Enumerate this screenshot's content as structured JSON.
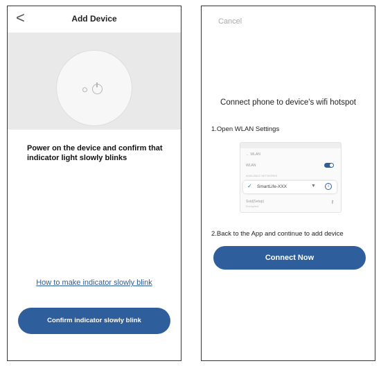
{
  "left_screen": {
    "back_glyph": "<",
    "title": "Add Device",
    "instruction": "Power on the device and confirm that indicator light slowly blinks",
    "help_link": "How to make indicator slowly blink",
    "confirm_button": "Confirm indicator slowly blink"
  },
  "right_screen": {
    "cancel": "Cancel",
    "heading": "Connect phone to device's wifi hotspot",
    "step1": "1.Open WLAN Settings",
    "mock": {
      "header": "← WLAN",
      "wlan_label": "WLAN",
      "section_label": "AVAILABLE NETWORKS",
      "network_ssid": "SmartLife-XXX",
      "more_label": "Ssid(Setup)",
      "more_sub": "Encrypted"
    },
    "step2": "2.Back to the App and continue to add device",
    "connect_button": "Connect Now"
  },
  "colors": {
    "accent": "#2f5e9c",
    "hero_bg": "#e9e9ea",
    "muted": "#aaaaaa"
  }
}
